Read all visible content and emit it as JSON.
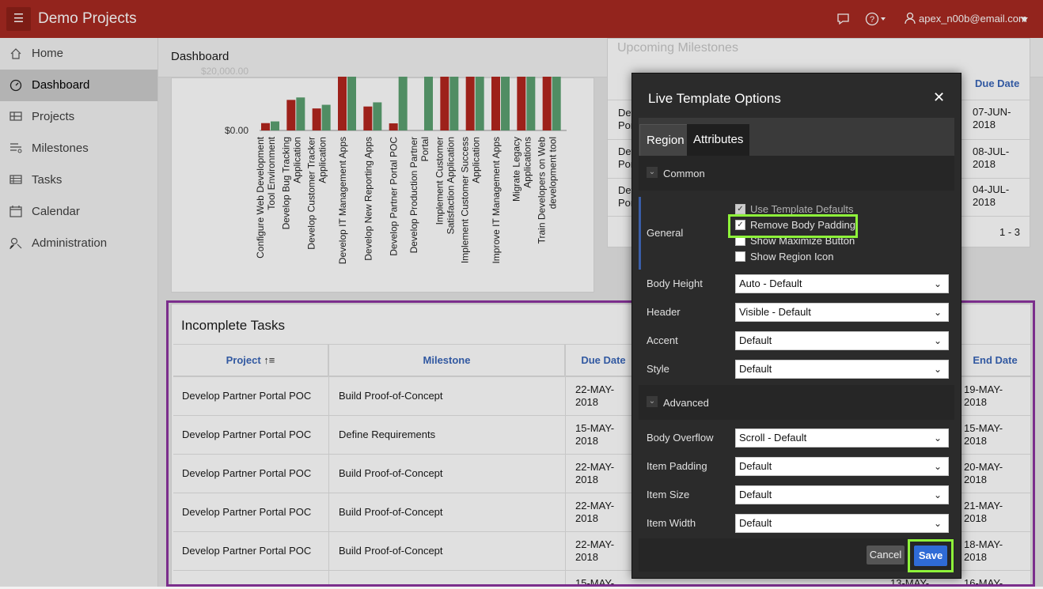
{
  "header": {
    "title": "Demo Projects",
    "user": "apex_n00b@email.com"
  },
  "sidebar": {
    "items": [
      {
        "label": "Home",
        "icon": "home-icon"
      },
      {
        "label": "Dashboard",
        "icon": "dashboard-icon",
        "active": true
      },
      {
        "label": "Projects",
        "icon": "projects-icon"
      },
      {
        "label": "Milestones",
        "icon": "milestones-icon"
      },
      {
        "label": "Tasks",
        "icon": "tasks-icon"
      },
      {
        "label": "Calendar",
        "icon": "calendar-icon"
      },
      {
        "label": "Administration",
        "icon": "administration-icon"
      }
    ]
  },
  "breadcrumb": "Dashboard",
  "milestones": {
    "title": "Upcoming Milestones",
    "due_header": "Due Date",
    "rows": [
      {
        "project": "Develo Porta",
        "due": "07-JUN-2018"
      },
      {
        "project": "Develo Porta",
        "due": "08-JUL-2018"
      },
      {
        "project": "Develo Porta",
        "due": "04-JUL-2018"
      }
    ],
    "pagination": "1 - 3"
  },
  "chart_data": {
    "type": "bar",
    "title": "",
    "y_ticks": [
      "$20,000.00",
      "$0.00"
    ],
    "categories": [
      "Configure Web Development Tool Environment",
      "Develop Bug Tracking Application",
      "Develop Customer Tracker Application",
      "Develop IT Management Apps",
      "Develop New Reporting Apps",
      "Develop Partner Portal POC",
      "Develop Production Partner Portal",
      "Implement Customer Satisfaction Application",
      "Implement Customer Success Application",
      "Improve IT Management Apps",
      "Migrate Legacy Applications",
      "Train Developers on Web development tool"
    ],
    "series": [
      {
        "color": "#b3261e",
        "values": [
          3000,
          12500,
          9000,
          22000,
          9800,
          2900,
          0,
          22000,
          22000,
          22000,
          22000,
          22000
        ]
      },
      {
        "color": "#5ca171",
        "values": [
          3700,
          13500,
          10500,
          22000,
          11500,
          22000,
          22000,
          22000,
          22000,
          22000,
          22000,
          22000
        ]
      }
    ]
  },
  "tasks": {
    "title": "Incomplete Tasks",
    "headers": {
      "project": "Project",
      "milestone": "Milestone",
      "due": "Due Date",
      "end": "End Date"
    },
    "rows": [
      {
        "project": "Develop Partner Portal POC",
        "milestone": "Build Proof-of-Concept",
        "due": "22-MAY-2018",
        "end": "19-MAY-2018"
      },
      {
        "project": "Develop Partner Portal POC",
        "milestone": "Define Requirements",
        "due": "15-MAY-2018",
        "end": "15-MAY-2018"
      },
      {
        "project": "Develop Partner Portal POC",
        "milestone": "Build Proof-of-Concept",
        "due": "22-MAY-2018",
        "end": "20-MAY-2018"
      },
      {
        "project": "Develop Partner Portal POC",
        "milestone": "Build Proof-of-Concept",
        "due": "22-MAY-2018",
        "end": "21-MAY-2018"
      },
      {
        "project": "Develop Partner Portal POC",
        "milestone": "Build Proof-of-Concept",
        "due": "22-MAY-2018",
        "end": "18-MAY-2018"
      },
      {
        "project": "",
        "milestone": "",
        "due": "15-MAY-",
        "end": "13-MAY-",
        "end2": "16-MAY-"
      }
    ]
  },
  "dialog": {
    "title": "Live Template Options",
    "tabs": [
      "Region",
      "Attributes"
    ],
    "common_label": "Common",
    "general_label": "General",
    "checkboxes": [
      {
        "label": "Use Template Defaults",
        "checked": true
      },
      {
        "label": "Remove Body Padding",
        "checked": true
      },
      {
        "label": "Show Maximize Button",
        "checked": false
      },
      {
        "label": "Show Region Icon",
        "checked": false
      }
    ],
    "fields_common": [
      {
        "label": "Body Height",
        "value": "Auto - Default"
      },
      {
        "label": "Header",
        "value": "Visible - Default"
      },
      {
        "label": "Accent",
        "value": "Default"
      },
      {
        "label": "Style",
        "value": "Default"
      }
    ],
    "advanced_label": "Advanced",
    "fields_advanced": [
      {
        "label": "Body Overflow",
        "value": "Scroll - Default"
      },
      {
        "label": "Item Padding",
        "value": "Default"
      },
      {
        "label": "Item Size",
        "value": "Default"
      },
      {
        "label": "Item Width",
        "value": "Default"
      }
    ],
    "cancel": "Cancel",
    "save": "Save"
  }
}
